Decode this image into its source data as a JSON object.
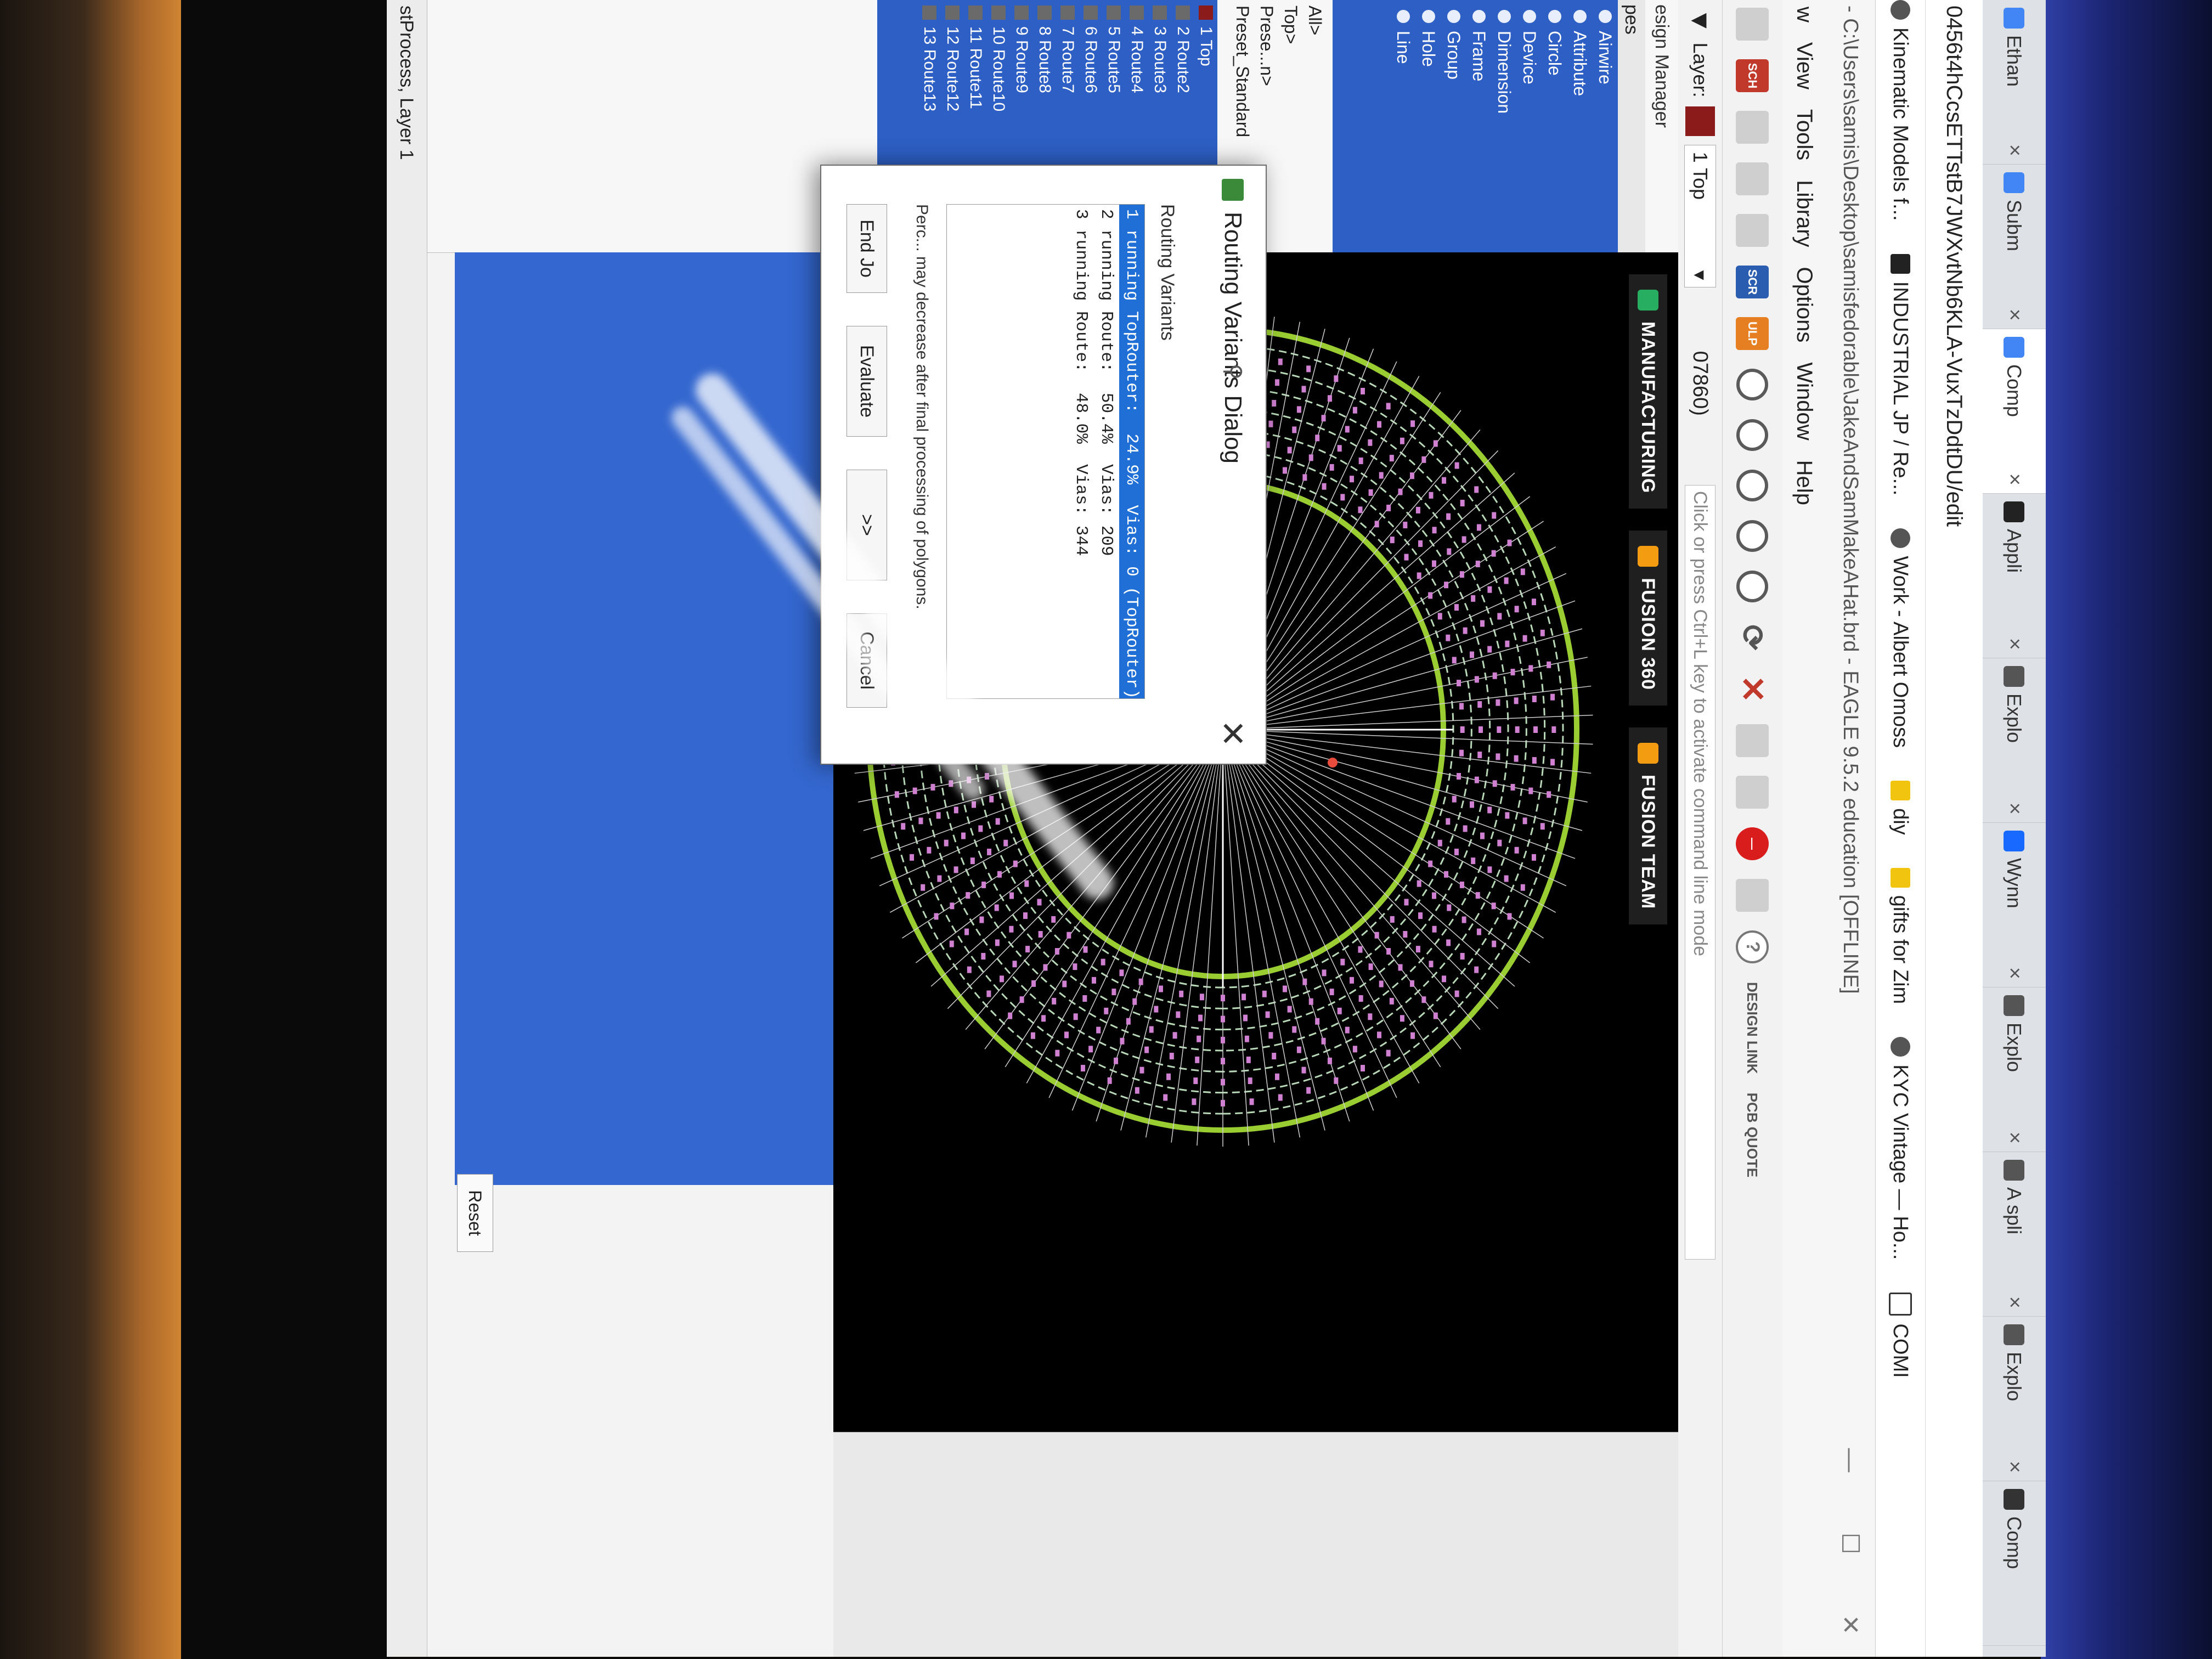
{
  "browser": {
    "tabs": [
      {
        "label": "Ethan",
        "color": "#4285f4"
      },
      {
        "label": "Subm",
        "color": "#4285f4"
      },
      {
        "label": "Comp",
        "color": "#4285f4",
        "active": true
      },
      {
        "label": "Appli",
        "color": "#222222"
      },
      {
        "label": "Explo",
        "color": "#555555"
      },
      {
        "label": "Wynn",
        "color": "#1769ff"
      },
      {
        "label": "Explo",
        "color": "#555555"
      },
      {
        "label": "A spli",
        "color": "#555555"
      },
      {
        "label": "Explo",
        "color": "#555555"
      },
      {
        "label": "Comp",
        "color": "#333333"
      }
    ],
    "address": "0456t4hCcsETTstB7JWXvtNb6KLA-VuxTzDdtDU/edit",
    "bookmarks": [
      "Kinematic Models f...",
      "INDUSTRIAL JP / Re...",
      "Work - Albert Omoss",
      "diy",
      "gifts for Zim",
      "KYC Vintage — Ho...",
      "COMI"
    ]
  },
  "eagle": {
    "title": "- C:\\Users\\samis\\Desktop\\samisfedorable\\JakeAndSamMakeAHat.brd - EAGLE 9.5.2 education [OFFLINE]",
    "menu": [
      "w",
      "View",
      "Tools",
      "Library",
      "Options",
      "Window",
      "Help"
    ],
    "toolbar": {
      "sch": "SCH",
      "scr": "SCR",
      "ulp": "ULP",
      "design_link": "DESIGN LINK",
      "pcb_quote": "PCB QUOTE"
    },
    "layer_label": "Layer:",
    "layer_value": "1 Top",
    "coordinate": "07860)",
    "command_hint": "Click or press Ctrl+L key to activate command line mode",
    "badges": [
      "MANUFACTURING",
      "FUSION 360",
      "FUSION TEAM"
    ],
    "badge_colors": [
      "#27ae60",
      "#f39c12",
      "#f39c12"
    ],
    "design_manager": "esign Manager",
    "types_header": "pes",
    "types": [
      "Airwire",
      "Attribute",
      "Circle",
      "Device",
      "Dimension",
      "Frame",
      "Group",
      "Hole",
      "Line"
    ],
    "filter_lines": [
      "All>",
      "Top>",
      "Prese...n>",
      "Preset_Standard"
    ],
    "routes": [
      {
        "label": "1 Top",
        "color": "#8b1a1a"
      },
      {
        "label": "2 Route2",
        "color": "#6a6a6a"
      },
      {
        "label": "3 Route3",
        "color": "#6a6a6a"
      },
      {
        "label": "4 Route4",
        "color": "#6a6a6a"
      },
      {
        "label": "5 Route5",
        "color": "#6a6a6a"
      },
      {
        "label": "6 Route6",
        "color": "#6a6a6a"
      },
      {
        "label": "7 Route7",
        "color": "#6a6a6a"
      },
      {
        "label": "8 Route8",
        "color": "#6a6a6a"
      },
      {
        "label": "9 Route9",
        "color": "#6a6a6a"
      },
      {
        "label": "10 Route10",
        "color": "#6a6a6a"
      },
      {
        "label": "11 Route11",
        "color": "#6a6a6a"
      },
      {
        "label": "12 Route12",
        "color": "#6a6a6a"
      },
      {
        "label": "13 Route13",
        "color": "#6a6a6a"
      }
    ],
    "reset": "Reset",
    "status": "stProcess, Layer 1"
  },
  "dialog": {
    "title": "Routing Variants Dialog",
    "group_label": "Routing Variants",
    "variants": [
      "1 running TopRouter:  24.9%  Vias: 0 (TopRouter)",
      "2 running Route:  50.4%  Vias: 209",
      "3 running Route:  48.0%  Vias: 344"
    ],
    "note": "Perc... may decrease after final processing of polygons.",
    "buttons": [
      "End Jo",
      "Evaluate",
      ">>",
      "Cancel"
    ]
  }
}
